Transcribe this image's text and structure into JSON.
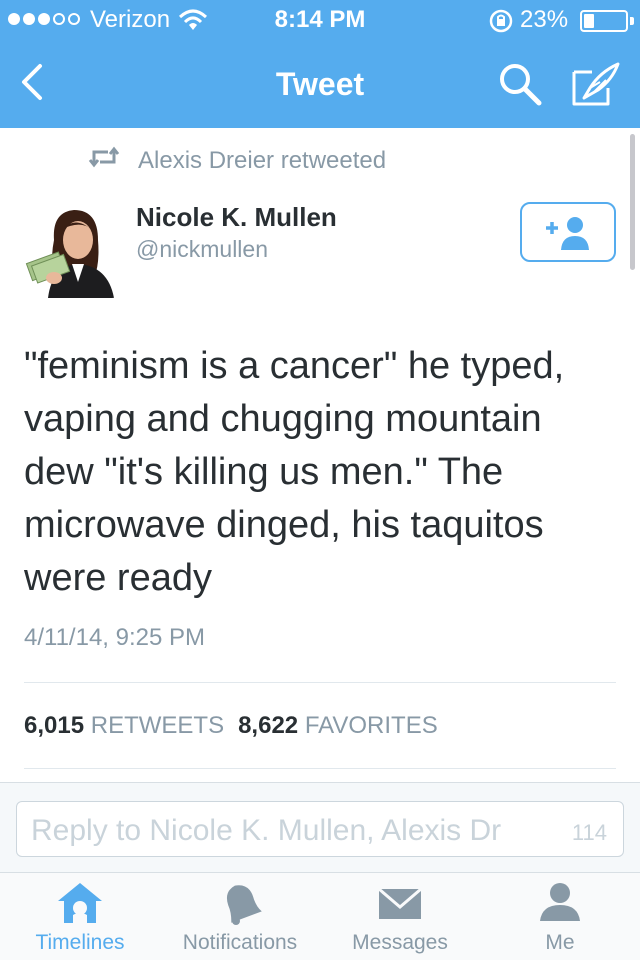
{
  "status_bar": {
    "carrier": "Verizon",
    "time": "8:14 PM",
    "battery_percent": "23%",
    "battery_level": 0.23,
    "signal_bars_filled": 3,
    "signal_bars_total": 5
  },
  "nav": {
    "title": "Tweet",
    "back_icon": "chevron-left-icon",
    "search_icon": "search-icon",
    "compose_icon": "compose-icon"
  },
  "tweet": {
    "retweeted_by": "Alexis Dreier retweeted",
    "author_name": "Nicole K. Mullen",
    "author_handle": "@nickmullen",
    "follow_icon": "add-user-icon",
    "text": "\"feminism is a cancer\" he typed, vaping and chugging mountain dew \"it's killing us men.\" The microwave dinged, his taquitos were ready",
    "date": "4/11/14, 9:25 PM",
    "retweets_count": "6,015",
    "retweets_label": "RETWEETS",
    "favorites_count": "8,622",
    "favorites_label": "FAVORITES"
  },
  "reply": {
    "placeholder": "Reply to Nicole K. Mullen, Alexis Dr",
    "char_count": "114"
  },
  "tabs": [
    {
      "label": "Timelines",
      "icon": "home-icon",
      "active": true
    },
    {
      "label": "Notifications",
      "icon": "bell-icon",
      "active": false
    },
    {
      "label": "Messages",
      "icon": "envelope-icon",
      "active": false
    },
    {
      "label": "Me",
      "icon": "person-icon",
      "active": false
    }
  ],
  "colors": {
    "accent": "#55acee",
    "text": "#292f33",
    "muted": "#8899a6",
    "tab_inactive": "#8899a6"
  }
}
